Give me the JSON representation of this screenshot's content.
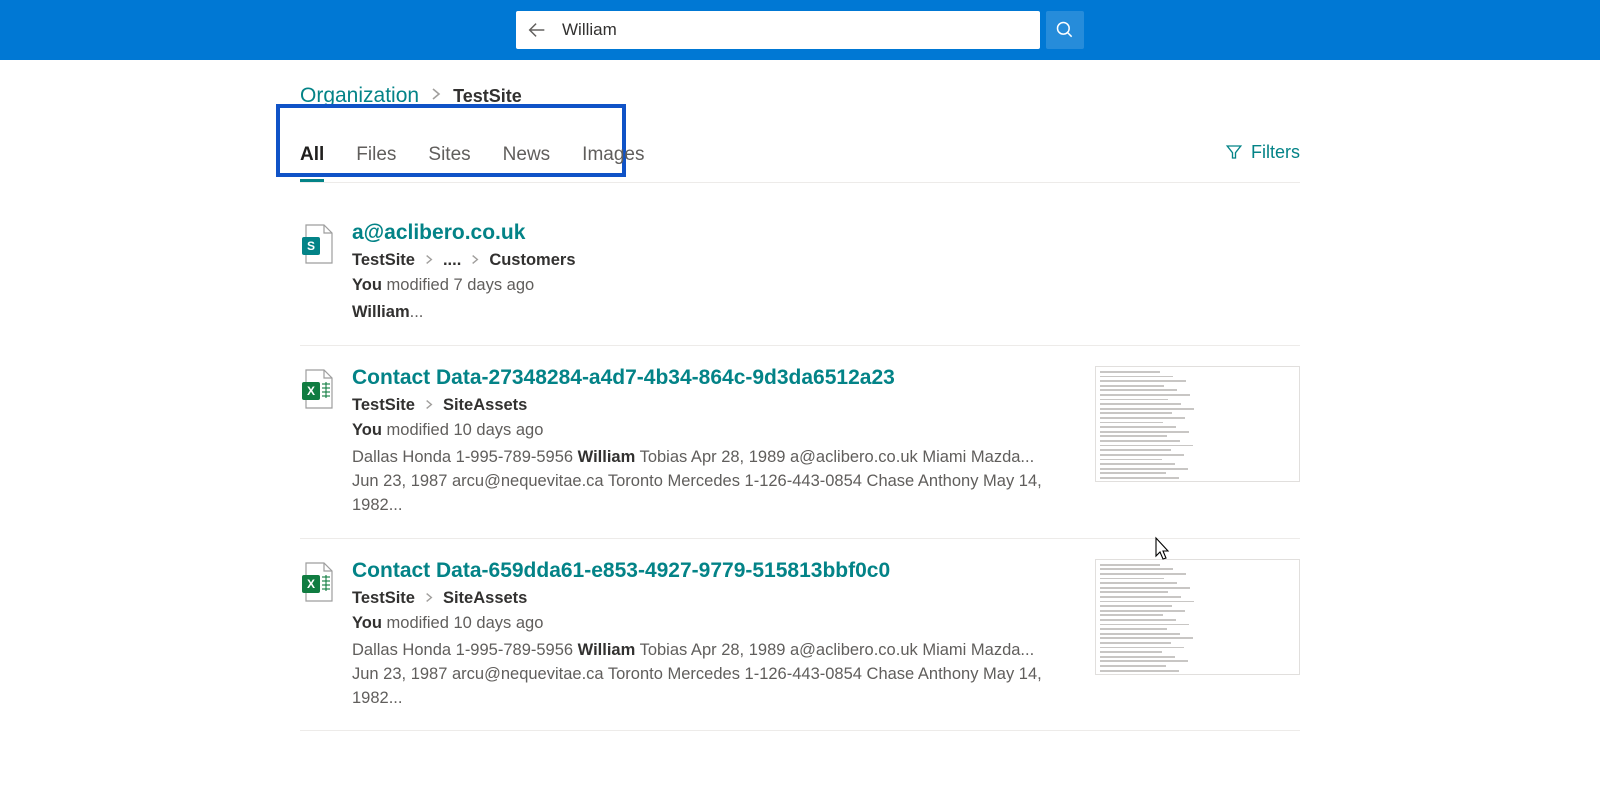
{
  "search": {
    "value": "William"
  },
  "breadcrumb": {
    "org": "Organization",
    "site": "TestSite"
  },
  "tabs": {
    "t0": "All",
    "t1": "Files",
    "t2": "Sites",
    "t3": "News",
    "t4": "Images",
    "active": "All"
  },
  "filters": {
    "label": "Filters"
  },
  "results": [
    {
      "icon": "sharepoint",
      "title": "a@aclibero.co.uk",
      "path": [
        "TestSite",
        "....",
        "Customers"
      ],
      "meta_prefix": "You",
      "meta_rest": " modified 7 days ago",
      "snippet_pre": "",
      "snippet_hl": "William",
      "snippet_post": "...",
      "thumb": false
    },
    {
      "icon": "excel",
      "title": "Contact Data-27348284-a4d7-4b34-864c-9d3da6512a23",
      "path": [
        "TestSite",
        "SiteAssets"
      ],
      "meta_prefix": "You",
      "meta_rest": " modified 10 days ago",
      "snippet_pre": "Dallas Honda 1-995-789-5956 ",
      "snippet_hl": "William",
      "snippet_post": " Tobias Apr 28, 1989 a@aclibero.co.uk Miami Mazda... Jun 23, 1987 arcu@nequevitae.ca Toronto Mercedes 1-126-443-0854 Chase Anthony May 14, 1982...",
      "thumb": true
    },
    {
      "icon": "excel",
      "title": "Contact Data-659dda61-e853-4927-9779-515813bbf0c0",
      "path": [
        "TestSite",
        "SiteAssets"
      ],
      "meta_prefix": "You",
      "meta_rest": " modified 10 days ago",
      "snippet_pre": "Dallas Honda 1-995-789-5956 ",
      "snippet_hl": "William",
      "snippet_post": " Tobias Apr 28, 1989 a@aclibero.co.uk Miami Mazda... Jun 23, 1987 arcu@nequevitae.ca Toronto Mercedes 1-126-443-0854 Chase Anthony May 14, 1982...",
      "thumb": true
    }
  ]
}
